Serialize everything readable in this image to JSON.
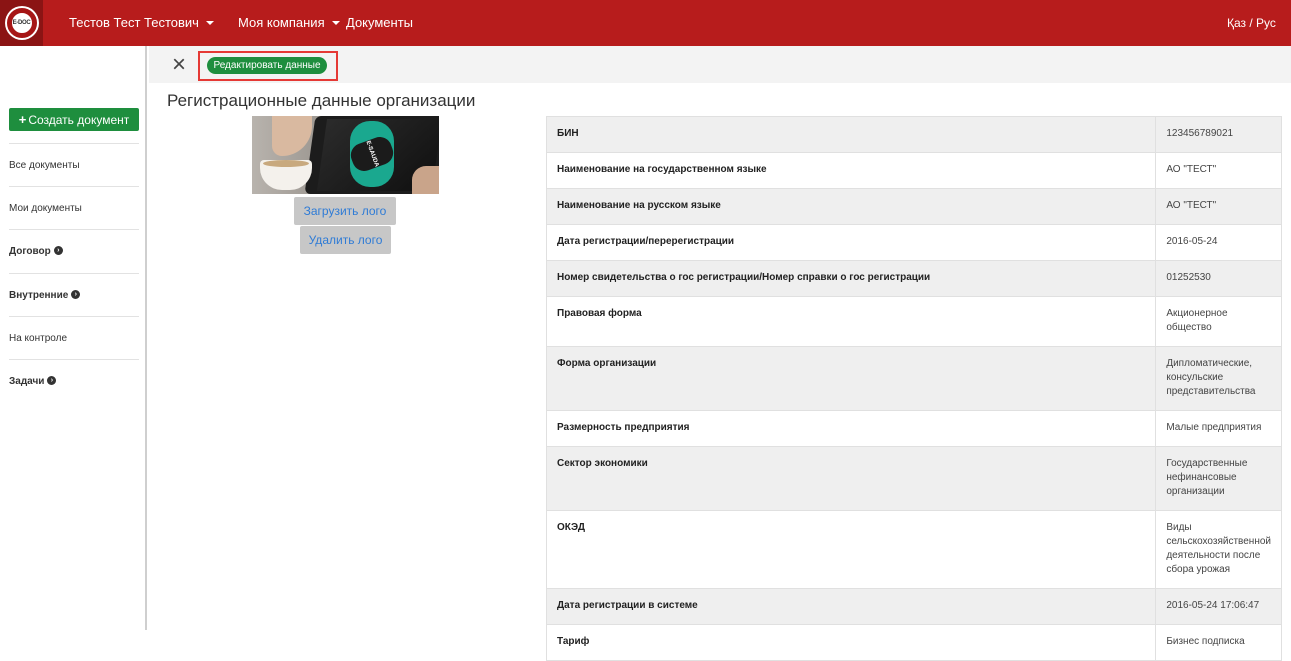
{
  "navbar": {
    "logo_text": "E-DOC",
    "user_menu": "Тестов Тест Тестович",
    "company_menu": "Моя компания",
    "documents_link": "Документы",
    "language_switch": "Қаз / Рус"
  },
  "sidebar": {
    "create_button": "Создать документ",
    "items": [
      {
        "label": "Все документы"
      },
      {
        "label": "Мои документы"
      },
      {
        "label": "Договор"
      },
      {
        "label": "Внутренние"
      },
      {
        "label": "На контроле"
      },
      {
        "label": "Задачи"
      }
    ]
  },
  "toolbar": {
    "edit_button": "Редактировать данные"
  },
  "page": {
    "title": "Регистрационные данные организации"
  },
  "logo_panel": {
    "image_text": "E-SAUDA",
    "upload_button": "Загрузить лого",
    "delete_button": "Удалить лого"
  },
  "registration_table": [
    {
      "label": "БИН",
      "value": "123456789021"
    },
    {
      "label": "Наименование на государственном языке",
      "value": "АО \"ТЕСТ\""
    },
    {
      "label": "Наименование на русском языке",
      "value": "АО \"ТЕСТ\""
    },
    {
      "label": "Дата регистрации/перерегистрации",
      "value": "2016-05-24"
    },
    {
      "label": "Номер свидетельства о гос регистрации/Номер справки о гос регистрации",
      "value": "01252530"
    },
    {
      "label": "Правовая форма",
      "value": "Акционерное общество"
    },
    {
      "label": "Форма организации",
      "value": "Дипломатические, консульские представительства"
    },
    {
      "label": "Размерность предприятия",
      "value": "Малые предприятия"
    },
    {
      "label": "Сектор экономики",
      "value": "Государственные нефинансовые организации"
    },
    {
      "label": "ОКЭД",
      "value": "Виды сельскохозяйственной деятельности после сбора урожая"
    },
    {
      "label": "Дата регистрации в системе",
      "value": "2016-05-24 17:06:47"
    },
    {
      "label": "Тариф",
      "value": "Бизнес подписка"
    }
  ]
}
